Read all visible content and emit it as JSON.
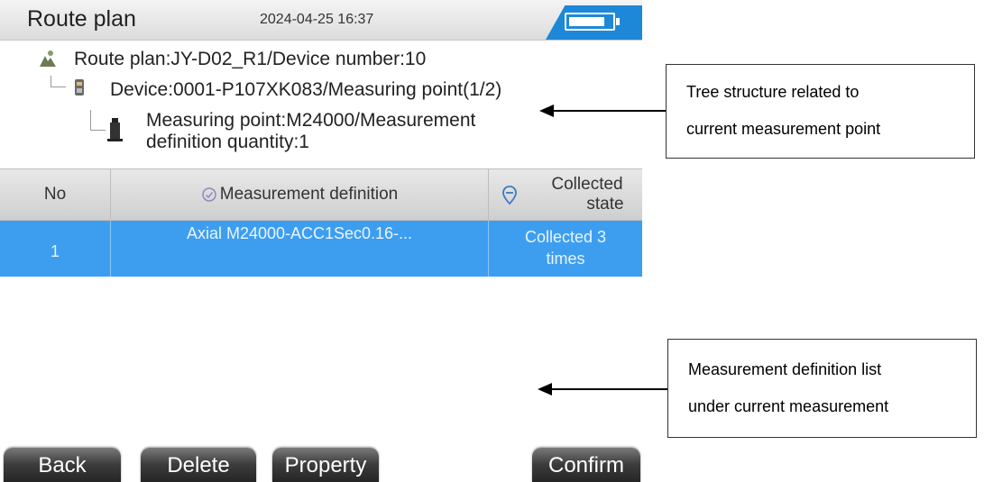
{
  "header": {
    "title": "Route plan",
    "datetime": "2024-04-25 16:37"
  },
  "tree": {
    "route": "Route plan:JY-D02_R1/Device number:10",
    "device": "Device:0001-P107XK083/Measuring point(1/2)",
    "point_line1": "Measuring point:M24000/Measurement",
    "point_line2": "definition quantity:1"
  },
  "table": {
    "col_no": "No",
    "col_definition": "Measurement definition",
    "col_state_line1": "Collected",
    "col_state_line2": "state",
    "rows": [
      {
        "no": "1",
        "definition": "Axial M24000-ACC1Sec0.16-...",
        "state_line1": "Collected 3",
        "state_line2": "times"
      }
    ]
  },
  "softkeys": {
    "back": "Back",
    "delete": "Delete",
    "property": "Property",
    "confirm": "Confirm"
  },
  "annotations": {
    "tree_line1": "Tree structure related to",
    "tree_line2": "current measurement point",
    "list_line1": "Measurement definition list",
    "list_line2": "under current measurement"
  },
  "colors": {
    "accent": "#1e88d8",
    "selected_row": "#3d9ef0",
    "softkey": "#2b2b2b"
  }
}
